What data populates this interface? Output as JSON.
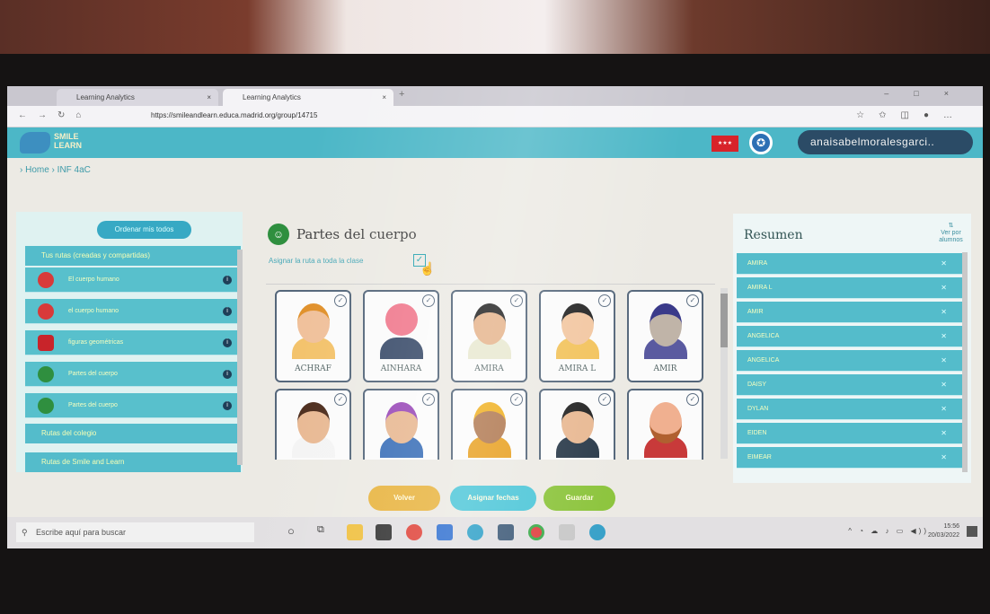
{
  "browser": {
    "tabs": [
      "Learning Analytics",
      "Learning Analytics"
    ],
    "tab_close": "×",
    "new_tab": "+",
    "url": "https://smileandlearn.educa.madrid.org/group/14715"
  },
  "app": {
    "logo_line1": "SMILE",
    "logo_line2": "LEARN",
    "user": "anaisabelmoralesgarci..",
    "breadcrumb": "› Home › INF 4aC"
  },
  "left_panel": {
    "order_button": "Ordenar mis todos",
    "section_mine": "Tus rutas (creadas y compartidas)",
    "routes": [
      {
        "label": "El cuerpo humano",
        "color": "#d83a3a"
      },
      {
        "label": "el cuerpo humano",
        "color": "#d83a3a"
      },
      {
        "label": "figuras geométricas",
        "color": "#c8242a"
      },
      {
        "label": "Partes del cuerpo",
        "color": "#2f8f3f"
      },
      {
        "label": "Partes del cuerpo",
        "color": "#2f8f3f"
      }
    ],
    "info_glyph": "i",
    "section_school": "Rutas del colegio",
    "section_smile": "Rutas de Smile and Learn"
  },
  "center": {
    "title": "Partes del cuerpo",
    "assign_label": "Asignar la ruta a toda la clase",
    "check_glyph": "✓",
    "students": [
      "ACHRAF",
      "AINHARA",
      "AMIRA",
      "AMIRA L",
      "AMIR",
      "",
      "",
      "",
      "",
      ""
    ]
  },
  "summary": {
    "title": "Resumen",
    "view_more": "Ver por alumnos",
    "remove_glyph": "✕",
    "rows": [
      "AMIRA",
      "AMIRA L",
      "AMIR",
      "ANGELICA",
      "ANGELICA",
      "DAISY",
      "DYLAN",
      "EIDEN",
      "EIMEAR"
    ]
  },
  "buttons": {
    "back": "Volver",
    "assign_dates": "Asignar fechas",
    "save": "Guardar"
  },
  "taskbar": {
    "search_placeholder": "Escribe aquí para buscar",
    "time": "15:56",
    "date": "20/03/2022"
  }
}
